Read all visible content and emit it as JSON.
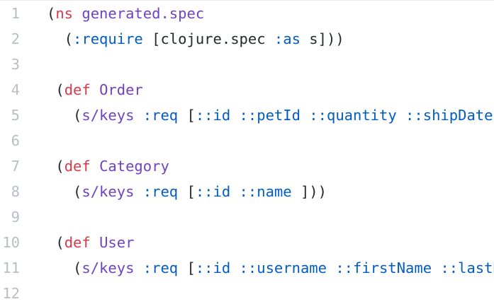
{
  "lines": [
    {
      "n": "1",
      "tokens": [
        {
          "t": "(",
          "c": "paren"
        },
        {
          "t": "ns",
          "c": "kw-ns"
        },
        {
          "t": " ",
          "c": "sym"
        },
        {
          "t": "generated.spec",
          "c": "name"
        }
      ]
    },
    {
      "n": "2",
      "tokens": [
        {
          "t": "  (",
          "c": "paren"
        },
        {
          "t": ":require",
          "c": "kwd"
        },
        {
          "t": " [clojure.spec ",
          "c": "sym"
        },
        {
          "t": ":as",
          "c": "kwd"
        },
        {
          "t": " s]))",
          "c": "sym"
        }
      ]
    },
    {
      "n": "3",
      "tokens": []
    },
    {
      "n": "4",
      "tokens": [
        {
          "t": " (",
          "c": "paren"
        },
        {
          "t": "def",
          "c": "kw-def"
        },
        {
          "t": " ",
          "c": "sym"
        },
        {
          "t": "Order",
          "c": "name"
        }
      ]
    },
    {
      "n": "5",
      "tokens": [
        {
          "t": "   (",
          "c": "paren"
        },
        {
          "t": "s/keys",
          "c": "fn"
        },
        {
          "t": " ",
          "c": "sym"
        },
        {
          "t": ":req",
          "c": "kwd"
        },
        {
          "t": " [",
          "c": "sym"
        },
        {
          "t": "::id ::petId ::quantity ::shipDate ::status ::complete",
          "c": "kwd"
        },
        {
          "t": " ]))",
          "c": "sym"
        }
      ]
    },
    {
      "n": "6",
      "tokens": []
    },
    {
      "n": "7",
      "tokens": [
        {
          "t": " (",
          "c": "paren"
        },
        {
          "t": "def",
          "c": "kw-def"
        },
        {
          "t": " ",
          "c": "sym"
        },
        {
          "t": "Category",
          "c": "name"
        }
      ]
    },
    {
      "n": "8",
      "tokens": [
        {
          "t": "   (",
          "c": "paren"
        },
        {
          "t": "s/keys",
          "c": "fn"
        },
        {
          "t": " ",
          "c": "sym"
        },
        {
          "t": ":req",
          "c": "kwd"
        },
        {
          "t": " [",
          "c": "sym"
        },
        {
          "t": "::id ::name",
          "c": "kwd"
        },
        {
          "t": " ]))",
          "c": "sym"
        }
      ]
    },
    {
      "n": "9",
      "tokens": []
    },
    {
      "n": "10",
      "tokens": [
        {
          "t": " (",
          "c": "paren"
        },
        {
          "t": "def",
          "c": "kw-def"
        },
        {
          "t": " ",
          "c": "sym"
        },
        {
          "t": "User",
          "c": "name"
        }
      ]
    },
    {
      "n": "11",
      "tokens": [
        {
          "t": "   (",
          "c": "paren"
        },
        {
          "t": "s/keys",
          "c": "fn"
        },
        {
          "t": " ",
          "c": "sym"
        },
        {
          "t": ":req",
          "c": "kwd"
        },
        {
          "t": " [",
          "c": "sym"
        },
        {
          "t": "::id ::username ::firstName ::lastName ::email ::password",
          "c": "kwd"
        },
        {
          "t": " ]))",
          "c": "sym"
        }
      ]
    },
    {
      "n": "12",
      "tokens": []
    }
  ]
}
